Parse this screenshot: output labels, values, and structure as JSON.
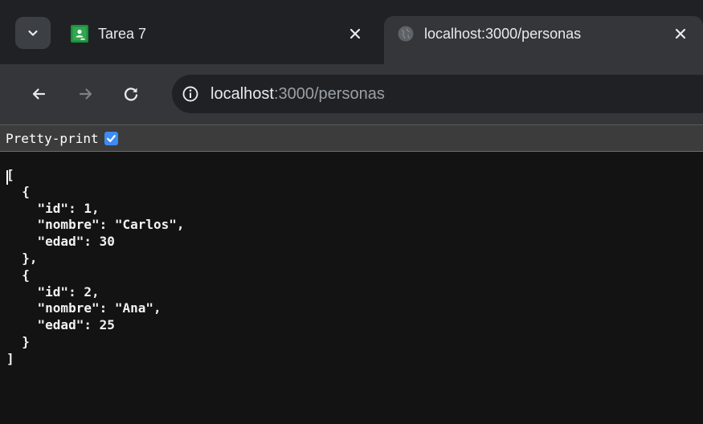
{
  "tabs": [
    {
      "title": "Tarea 7",
      "active": false,
      "favicon": "google-classroom-icon",
      "favicon_color": "#1e8e3e"
    },
    {
      "title": "localhost:3000/personas",
      "active": true,
      "favicon": "globe-icon"
    }
  ],
  "toolbar": {
    "back_icon": "back-arrow-icon",
    "forward_icon": "forward-arrow-icon",
    "reload_icon": "reload-icon",
    "site_info_icon": "info-icon",
    "url_host": "localhost",
    "url_rest": ":3000/personas"
  },
  "viewer": {
    "pretty_print_label": "Pretty-print",
    "pretty_print_checked": true,
    "checkbox_color": "#3d8bf2",
    "json_text": "[\n  {\n    \"id\": 1,\n    \"nombre\": \"Carlos\",\n    \"edad\": 30\n  },\n  {\n    \"id\": 2,\n    \"nombre\": \"Ana\",\n    \"edad\": 25\n  }\n]"
  },
  "colors": {
    "tabbar_bg": "#202124",
    "toolbar_bg": "#35363a",
    "page_bg": "#131313"
  }
}
